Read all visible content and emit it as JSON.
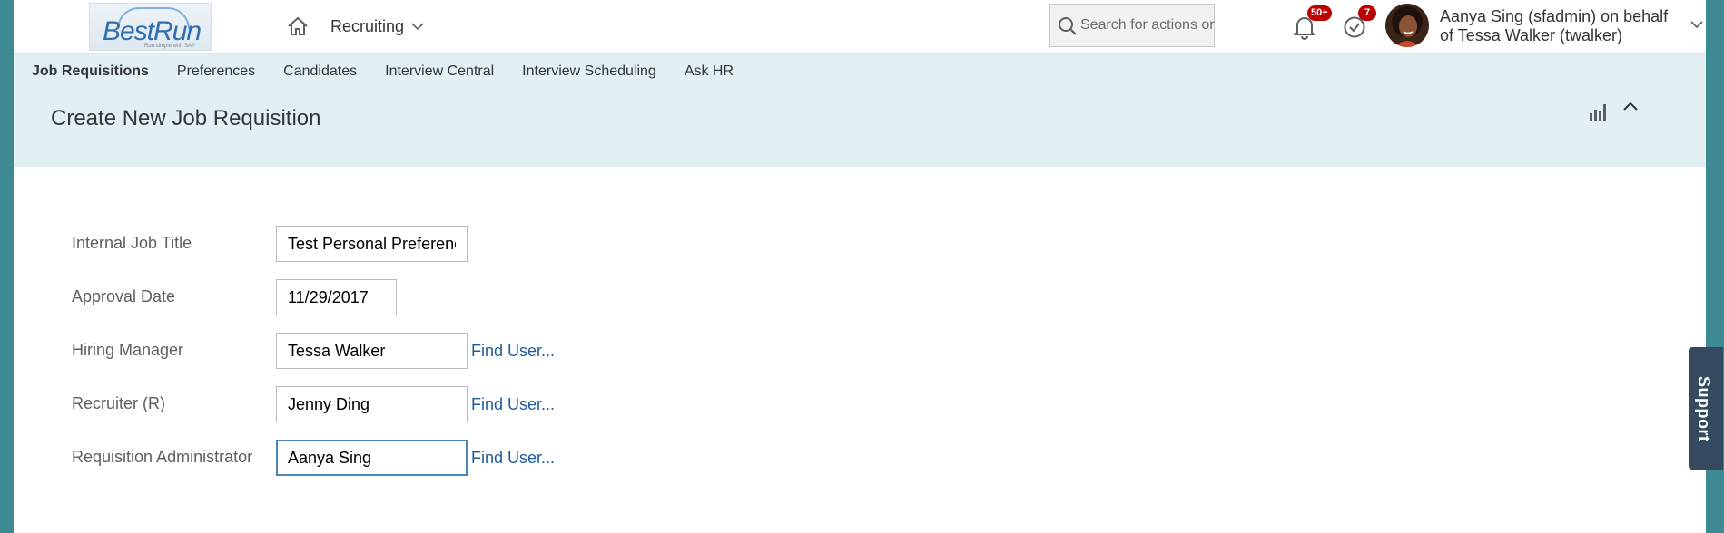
{
  "header": {
    "logo_text": "BestRun",
    "logo_tagline": "Run simple with SAP",
    "product_menu_label": "Recruiting",
    "search_placeholder": "Search for actions or people",
    "notifications_badge": "50+",
    "approvals_badge": "7",
    "user_name": "Aanya Sing (sfadmin) on behalf of Tessa Walker (twalker)"
  },
  "subnav": {
    "tabs": [
      {
        "label": "Job Requisitions",
        "active": true
      },
      {
        "label": "Preferences",
        "active": false
      },
      {
        "label": "Candidates",
        "active": false
      },
      {
        "label": "Interview Central",
        "active": false
      },
      {
        "label": "Interview Scheduling",
        "active": false
      },
      {
        "label": "Ask HR",
        "active": false
      }
    ]
  },
  "page": {
    "title": "Create New Job Requisition"
  },
  "form": {
    "find_user_label": "Find User...",
    "fields": [
      {
        "label": "Internal Job Title",
        "value": "Test Personal Preference"
      },
      {
        "label": "Approval Date",
        "value": "11/29/2017"
      },
      {
        "label": "Hiring Manager",
        "value": "Tessa Walker"
      },
      {
        "label": "Recruiter (R)",
        "value": "Jenny Ding"
      },
      {
        "label": "Requisition Administrator",
        "value": "Aanya Sing"
      }
    ]
  },
  "support": {
    "label": "Support"
  },
  "colors": {
    "band": "#e2f0f3",
    "edge": "#3d8a93",
    "link": "#1f5c99",
    "badge": "#bb0000",
    "support": "#354a5f"
  }
}
